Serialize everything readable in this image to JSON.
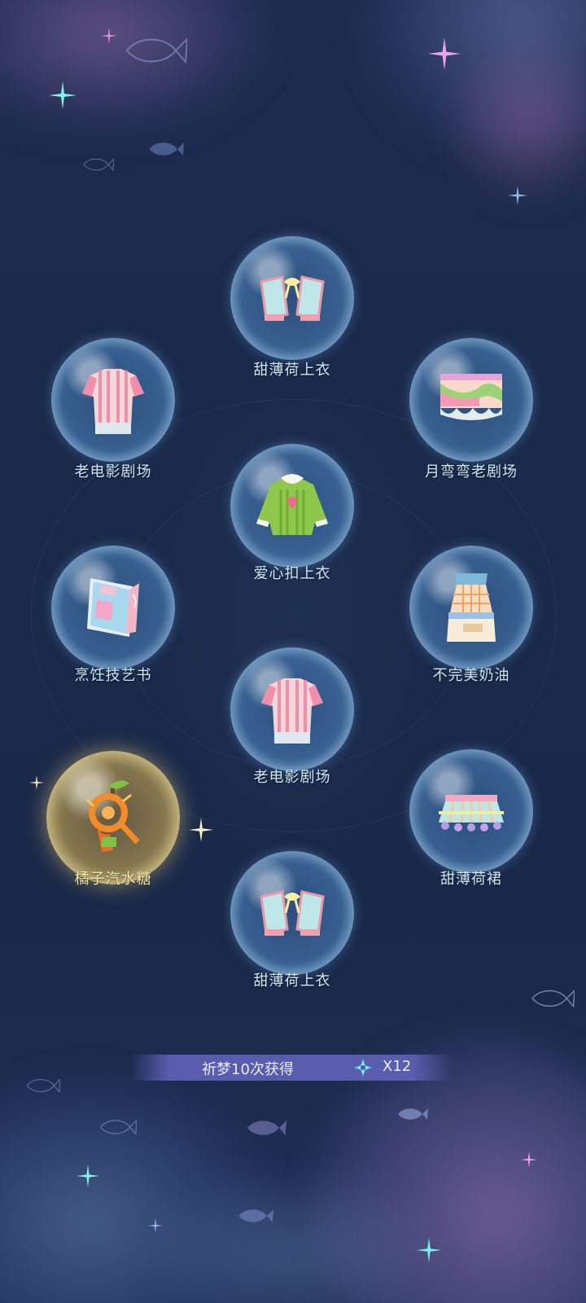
{
  "items": [
    {
      "label": "甜薄荷上衣",
      "icon": "mint-top-icon",
      "highlight": false
    },
    {
      "label": "老电影剧场",
      "icon": "pink-striped-shirt-icon",
      "highlight": false
    },
    {
      "label": "月弯弯老剧场",
      "icon": "pink-green-skirt-icon",
      "highlight": false
    },
    {
      "label": "爱心扣上衣",
      "icon": "green-heart-jacket-icon",
      "highlight": false
    },
    {
      "label": "烹饪技艺书",
      "icon": "cooking-book-icon",
      "highlight": false
    },
    {
      "label": "不完美奶油",
      "icon": "plaid-dress-icon",
      "highlight": false
    },
    {
      "label": "老电影剧场",
      "icon": "pink-striped-shirt-icon",
      "highlight": false
    },
    {
      "label": "橘子汽水糖",
      "icon": "orange-soda-candy-icon",
      "highlight": true
    },
    {
      "label": "甜薄荷裙",
      "icon": "mint-skirt-icon",
      "highlight": false
    },
    {
      "label": "甜薄荷上衣",
      "icon": "mint-top-icon",
      "highlight": false
    }
  ],
  "reward": {
    "text": "祈梦10次获得",
    "icon": "crystal-star-icon",
    "count": "X12"
  },
  "colors": {
    "background": "#1b2a4a",
    "label": "#cfe6f3",
    "highlight_label": "#f3e7a4",
    "reward_bar": "#6464be"
  }
}
